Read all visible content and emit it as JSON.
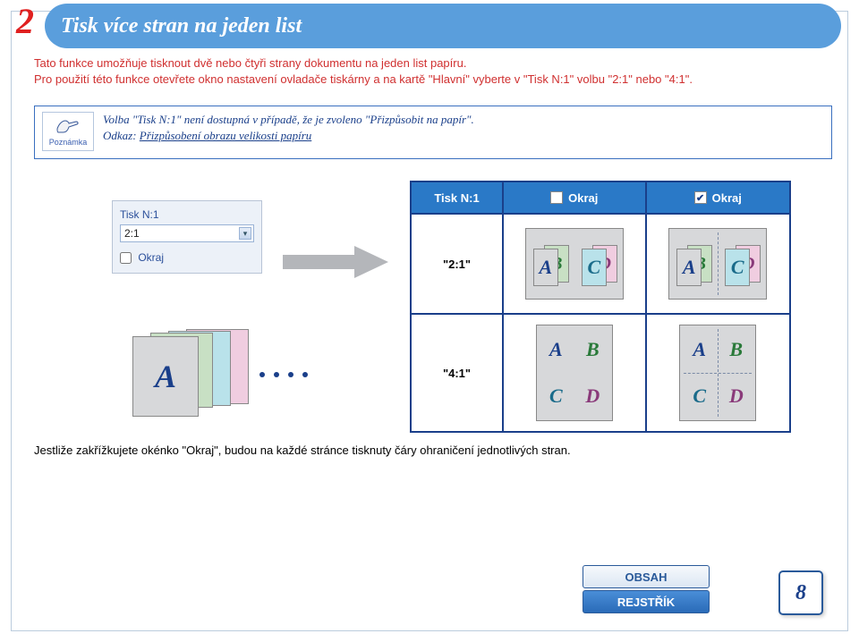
{
  "section": {
    "number": "2",
    "title": "Tisk více stran na jeden list"
  },
  "intro": {
    "p1": "Tato funkce umožňuje tisknout dvě nebo čtyři strany dokumentu na jeden list papíru.",
    "p2": "Pro použití této funkce otevřete okno nastavení ovladače tiskárny a na kartě \"Hlavní\" vyberte v \"Tisk N:1\" volbu \"2:1\" nebo \"4:1\"."
  },
  "note": {
    "label": "Poznámka",
    "line1": "Volba \"Tisk N:1\" není dostupná v případě, že je zvoleno \"Přizpůsobit na papír\".",
    "linklabel": "Odkaz:",
    "link": "Přizpůsobení obrazu velikosti papíru"
  },
  "dialog": {
    "field_label": "Tisk N:1",
    "combo_value": "2:1",
    "okraj_label": "Okraj"
  },
  "table": {
    "header_col0": "Tisk N:1",
    "header_col1": "Okraj",
    "header_col2": "Okraj",
    "row1_label": "\"2:1\"",
    "row2_label": "\"4:1\"",
    "letters": {
      "A": "A",
      "B": "B",
      "C": "C",
      "D": "D"
    }
  },
  "footer_text": "Jestliže zakřížkujete okénko \"Okraj\", budou na každé stránce tisknuty čáry ohraničení jednotlivých stran.",
  "nav": {
    "obsah": "OBSAH",
    "rejstrik": "REJSTŘÍK"
  },
  "page_number": "8"
}
